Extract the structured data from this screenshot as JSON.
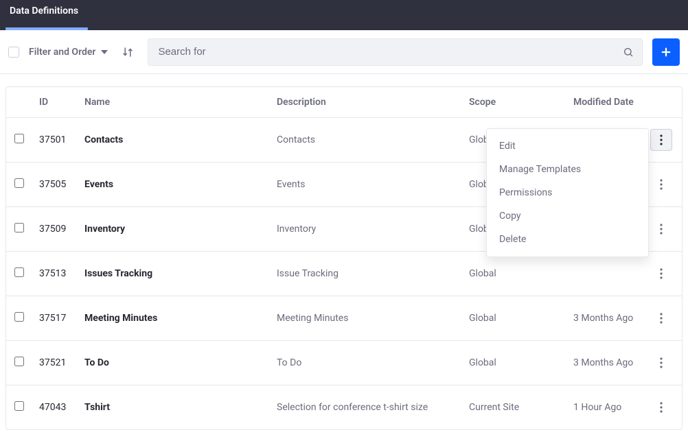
{
  "tabs": {
    "active": {
      "label": "Data Definitions"
    }
  },
  "toolbar": {
    "filter_label": "Filter and Order",
    "search_placeholder": "Search for"
  },
  "table": {
    "headers": {
      "id": "ID",
      "name": "Name",
      "description": "Description",
      "scope": "Scope",
      "modified": "Modified Date"
    },
    "rows": [
      {
        "id": "37501",
        "name": "Contacts",
        "description": "Contacts",
        "scope": "Global",
        "modified": ""
      },
      {
        "id": "37505",
        "name": "Events",
        "description": "Events",
        "scope": "Global",
        "modified": ""
      },
      {
        "id": "37509",
        "name": "Inventory",
        "description": "Inventory",
        "scope": "Global",
        "modified": ""
      },
      {
        "id": "37513",
        "name": "Issues Tracking",
        "description": "Issue Tracking",
        "scope": "Global",
        "modified": ""
      },
      {
        "id": "37517",
        "name": "Meeting Minutes",
        "description": "Meeting Minutes",
        "scope": "Global",
        "modified": "3 Months Ago"
      },
      {
        "id": "37521",
        "name": "To Do",
        "description": "To Do",
        "scope": "Global",
        "modified": "3 Months Ago"
      },
      {
        "id": "47043",
        "name": "Tshirt",
        "description": "Selection for conference t-shirt size",
        "scope": "Current Site",
        "modified": "1 Hour Ago"
      }
    ]
  },
  "menu": {
    "items": [
      {
        "label": "Edit"
      },
      {
        "label": "Manage Templates"
      },
      {
        "label": "Permissions"
      },
      {
        "label": "Copy"
      },
      {
        "label": "Delete"
      }
    ]
  }
}
